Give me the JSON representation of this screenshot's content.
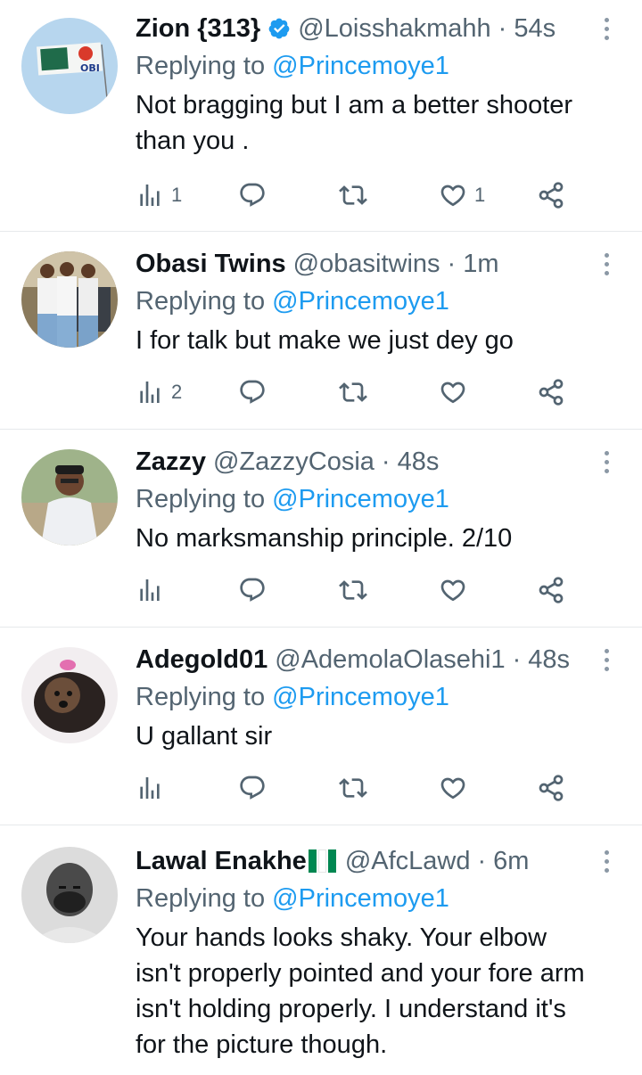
{
  "replying_prefix": "Replying to",
  "tweets": [
    {
      "name": "Zion {313}",
      "verified": true,
      "handle": "@Loisshakmahh",
      "time": "54s",
      "reply_to": "@Princemoye1",
      "text_lines": [
        "Not bragging but I am a better shooter",
        "than you ."
      ],
      "views": "1",
      "likes": "1"
    },
    {
      "name": "Obasi Twins",
      "handle": "@obasitwins",
      "time": "1m",
      "reply_to": "@Princemoye1",
      "text_lines": [
        "I for talk but make we just dey go"
      ],
      "views": "2",
      "likes": ""
    },
    {
      "name": "Zazzy",
      "handle": "@ZazzyCosia",
      "time": "48s",
      "reply_to": "@Princemoye1",
      "text_lines": [
        "No marksmanship principle. 2/10"
      ],
      "views": "",
      "likes": ""
    },
    {
      "name": "Adegold01",
      "handle": "@AdemolaOlasehi1",
      "time": "48s",
      "reply_to": "@Princemoye1",
      "text_lines": [
        "U gallant sir"
      ],
      "views": "",
      "likes": ""
    },
    {
      "name": "Lawal Enakhe",
      "flag_colors": [
        "#008751",
        "#ffffff",
        "#008751"
      ],
      "handle": "@AfcLawd",
      "time": "6m",
      "reply_to": "@Princemoye1",
      "text_lines": [
        "Your hands looks shaky. Your elbow",
        "isn't properly pointed and your fore arm",
        "isn't holding properly. I understand it's",
        "for the picture though."
      ]
    }
  ],
  "colors": {
    "link": "#1d9bf0",
    "secondary": "#536471",
    "verified": "#1d9bf0"
  }
}
